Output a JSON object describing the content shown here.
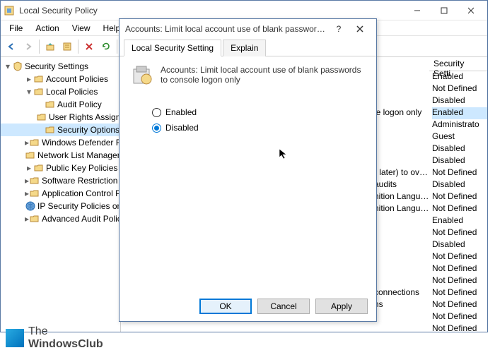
{
  "window": {
    "title": "Local Security Policy",
    "menu": [
      "File",
      "Action",
      "View",
      "Help"
    ]
  },
  "tree": {
    "root": "Security Settings",
    "items": [
      {
        "label": "Account Policies",
        "ind": 2,
        "tw": "▸"
      },
      {
        "label": "Local Policies",
        "ind": 2,
        "tw": "▾"
      },
      {
        "label": "Audit Policy",
        "ind": 3,
        "tw": ""
      },
      {
        "label": "User Rights Assignmen",
        "ind": 3,
        "tw": ""
      },
      {
        "label": "Security Options",
        "ind": 3,
        "tw": "",
        "sel": true
      },
      {
        "label": "Windows Defender Firewal",
        "ind": 2,
        "tw": "▸"
      },
      {
        "label": "Network List Manager Poli",
        "ind": 2,
        "tw": ""
      },
      {
        "label": "Public Key Policies",
        "ind": 2,
        "tw": "▸"
      },
      {
        "label": "Software Restriction Polici",
        "ind": 2,
        "tw": "▸"
      },
      {
        "label": "Application Control Polici",
        "ind": 2,
        "tw": "▸"
      },
      {
        "label": "IP Security Policies on Loca",
        "ind": 2,
        "tw": "",
        "ip": true
      },
      {
        "label": "Advanced Audit Policy Co",
        "ind": 2,
        "tw": "▸"
      }
    ]
  },
  "list": {
    "header": "Security Setti",
    "rows": [
      {
        "c1": "",
        "c2": "Enabled"
      },
      {
        "c1": "",
        "c2": "Not Defined"
      },
      {
        "c1": "",
        "c2": "Disabled"
      },
      {
        "c1": "le logon only",
        "c2": "Enabled",
        "sel": true
      },
      {
        "c1": "",
        "c2": "Administrato"
      },
      {
        "c1": "",
        "c2": "Guest"
      },
      {
        "c1": "",
        "c2": "Disabled"
      },
      {
        "c1": "",
        "c2": "Disabled"
      },
      {
        "c1": "r later) to ove...",
        "c2": "Not Defined"
      },
      {
        "c1": "audits",
        "c2": "Disabled"
      },
      {
        "c1": "nition Langua...",
        "c2": "Not Defined"
      },
      {
        "c1": "nition Langua...",
        "c2": "Not Defined"
      },
      {
        "c1": "",
        "c2": "Enabled"
      },
      {
        "c1": "",
        "c2": "Not Defined"
      },
      {
        "c1": "",
        "c2": "Disabled"
      },
      {
        "c1": "",
        "c2": "Not Defined"
      },
      {
        "c1": "",
        "c2": "Not Defined"
      },
      {
        "c1": "",
        "c2": "Not Defined"
      },
      {
        "c1": "connections",
        "c2": "Not Defined"
      },
      {
        "c1": "ns",
        "c2": "Not Defined"
      },
      {
        "c1": "",
        "c2": "Not Defined"
      },
      {
        "c1": "",
        "c2": "Not Defined"
      }
    ]
  },
  "dialog": {
    "title": "Accounts: Limit local account use of blank passwords to c...",
    "tabs": {
      "setting": "Local Security Setting",
      "explain": "Explain"
    },
    "desc": "Accounts: Limit local account use of blank passwords to console logon only",
    "radios": {
      "enabled": "Enabled",
      "disabled": "Disabled"
    },
    "buttons": {
      "ok": "OK",
      "cancel": "Cancel",
      "apply": "Apply"
    }
  },
  "watermark": {
    "l1": "The",
    "l2": "WindowsClub"
  }
}
